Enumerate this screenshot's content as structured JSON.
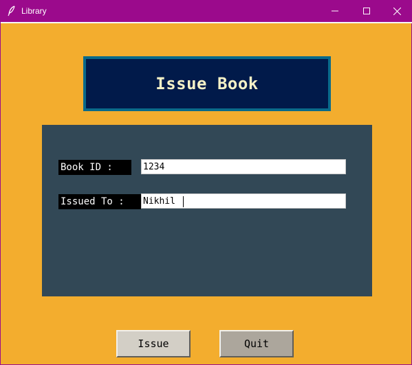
{
  "window": {
    "title": "Library",
    "icon": "feather-icon",
    "titlebar_color": "#9b0a8c",
    "background_color": "#f3ad2e",
    "controls": {
      "minimize": "minimize-icon",
      "maximize": "maximize-icon",
      "close": "close-icon"
    }
  },
  "heading": {
    "text": "Issue Book",
    "frame_color": "#0a6a8a",
    "background_color": "#011a4a",
    "text_color": "#f4f1c7"
  },
  "form": {
    "panel_color": "#324856",
    "book_id": {
      "label": "Book ID : ",
      "value": "1234"
    },
    "issued_to": {
      "label": "Issued To : ",
      "value": "Nikhil"
    }
  },
  "buttons": {
    "issue": "Issue",
    "quit": "Quit"
  }
}
